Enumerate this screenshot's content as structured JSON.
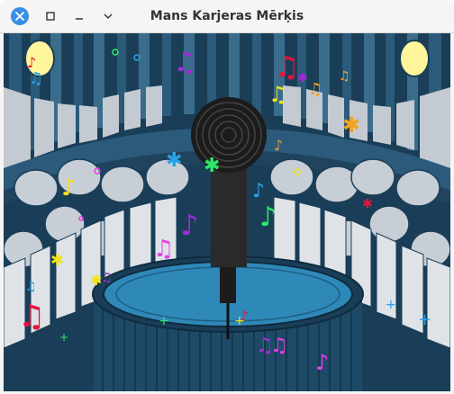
{
  "window": {
    "title": "Mans Karjeras Mērķis"
  },
  "titlebar_buttons": [
    {
      "name": "close",
      "icon": "close-icon"
    },
    {
      "name": "maximize",
      "icon": "maximize-icon"
    },
    {
      "name": "minimize",
      "icon": "minimize-icon"
    },
    {
      "name": "menu",
      "icon": "chevron-down-icon"
    }
  ],
  "scene": {
    "description_icons": [
      "microphone-icon",
      "spotlight-icon",
      "music-note-icon",
      "star-icon",
      "stage-icon"
    ],
    "colors": {
      "background": "#1a3e58",
      "wall_stripe": "#2b5a7a",
      "crowd": "#c8ced6",
      "balcony": "#dfe3e8",
      "stage_top": "#2f89b8",
      "stage_side": "#1e4a68",
      "microphone": "#1c1c1c",
      "spotlight": "#fff59a"
    }
  }
}
